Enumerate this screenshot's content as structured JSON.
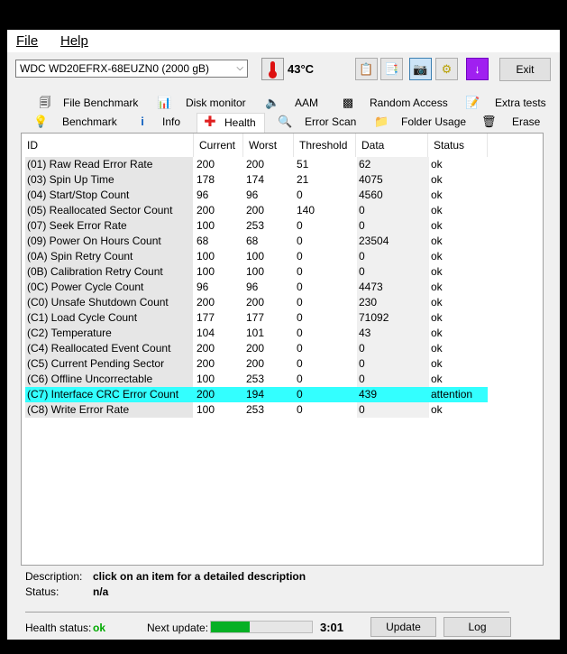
{
  "menu": {
    "file": "File",
    "help": "Help"
  },
  "toolbar": {
    "drive": "WDC WD20EFRX-68EUZN0 (2000 gB)",
    "temperature": "43°C",
    "exit": "Exit"
  },
  "tabs": {
    "row1": [
      {
        "label": "File Benchmark",
        "icon": "file-benchmark-icon"
      },
      {
        "label": "Disk monitor",
        "icon": "disk-monitor-icon"
      },
      {
        "label": "AAM",
        "icon": "speaker-icon"
      },
      {
        "label": "Random Access",
        "icon": "random-access-icon"
      },
      {
        "label": "Extra tests",
        "icon": "extra-tests-icon"
      }
    ],
    "row2": [
      {
        "label": "Benchmark",
        "icon": "lightbulb-icon"
      },
      {
        "label": "Info",
        "icon": "info-icon"
      },
      {
        "label": "Health",
        "icon": "health-cross-icon"
      },
      {
        "label": "Error Scan",
        "icon": "magnifier-icon"
      },
      {
        "label": "Folder Usage",
        "icon": "folder-icon"
      },
      {
        "label": "Erase",
        "icon": "trash-icon"
      }
    ]
  },
  "table": {
    "headers": [
      "ID",
      "Current",
      "Worst",
      "Threshold",
      "Data",
      "Status"
    ],
    "rows": [
      [
        "(01) Raw Read Error Rate",
        "200",
        "200",
        "51",
        "62",
        "ok"
      ],
      [
        "(03) Spin Up Time",
        "178",
        "174",
        "21",
        "4075",
        "ok"
      ],
      [
        "(04) Start/Stop Count",
        "96",
        "96",
        "0",
        "4560",
        "ok"
      ],
      [
        "(05) Reallocated Sector Count",
        "200",
        "200",
        "140",
        "0",
        "ok"
      ],
      [
        "(07) Seek Error Rate",
        "100",
        "253",
        "0",
        "0",
        "ok"
      ],
      [
        "(09) Power On Hours Count",
        "68",
        "68",
        "0",
        "23504",
        "ok"
      ],
      [
        "(0A) Spin Retry Count",
        "100",
        "100",
        "0",
        "0",
        "ok"
      ],
      [
        "(0B) Calibration Retry Count",
        "100",
        "100",
        "0",
        "0",
        "ok"
      ],
      [
        "(0C) Power Cycle Count",
        "96",
        "96",
        "0",
        "4473",
        "ok"
      ],
      [
        "(C0) Unsafe Shutdown Count",
        "200",
        "200",
        "0",
        "230",
        "ok"
      ],
      [
        "(C1) Load Cycle Count",
        "177",
        "177",
        "0",
        "71092",
        "ok"
      ],
      [
        "(C2) Temperature",
        "104",
        "101",
        "0",
        "43",
        "ok"
      ],
      [
        "(C4) Reallocated Event Count",
        "200",
        "200",
        "0",
        "0",
        "ok"
      ],
      [
        "(C5) Current Pending Sector",
        "200",
        "200",
        "0",
        "0",
        "ok"
      ],
      [
        "(C6) Offline Uncorrectable",
        "100",
        "253",
        "0",
        "0",
        "ok"
      ],
      [
        "(C7) Interface CRC Error Count",
        "200",
        "194",
        "0",
        "439",
        "attention"
      ],
      [
        "(C8) Write Error Rate",
        "100",
        "253",
        "0",
        "0",
        "ok"
      ]
    ],
    "highlighted_row": 15,
    "highlight_color": "#33ffff"
  },
  "footer": {
    "description_label": "Description:",
    "description_value": "click on an item for a detailed description",
    "status_label": "Status:",
    "status_value": "n/a",
    "health_label": "Health status:",
    "health_value": "ok",
    "next_update_label": "Next update:",
    "next_update_progress": 0.38,
    "timer": "3:01",
    "update_button": "Update",
    "log_button": "Log"
  }
}
